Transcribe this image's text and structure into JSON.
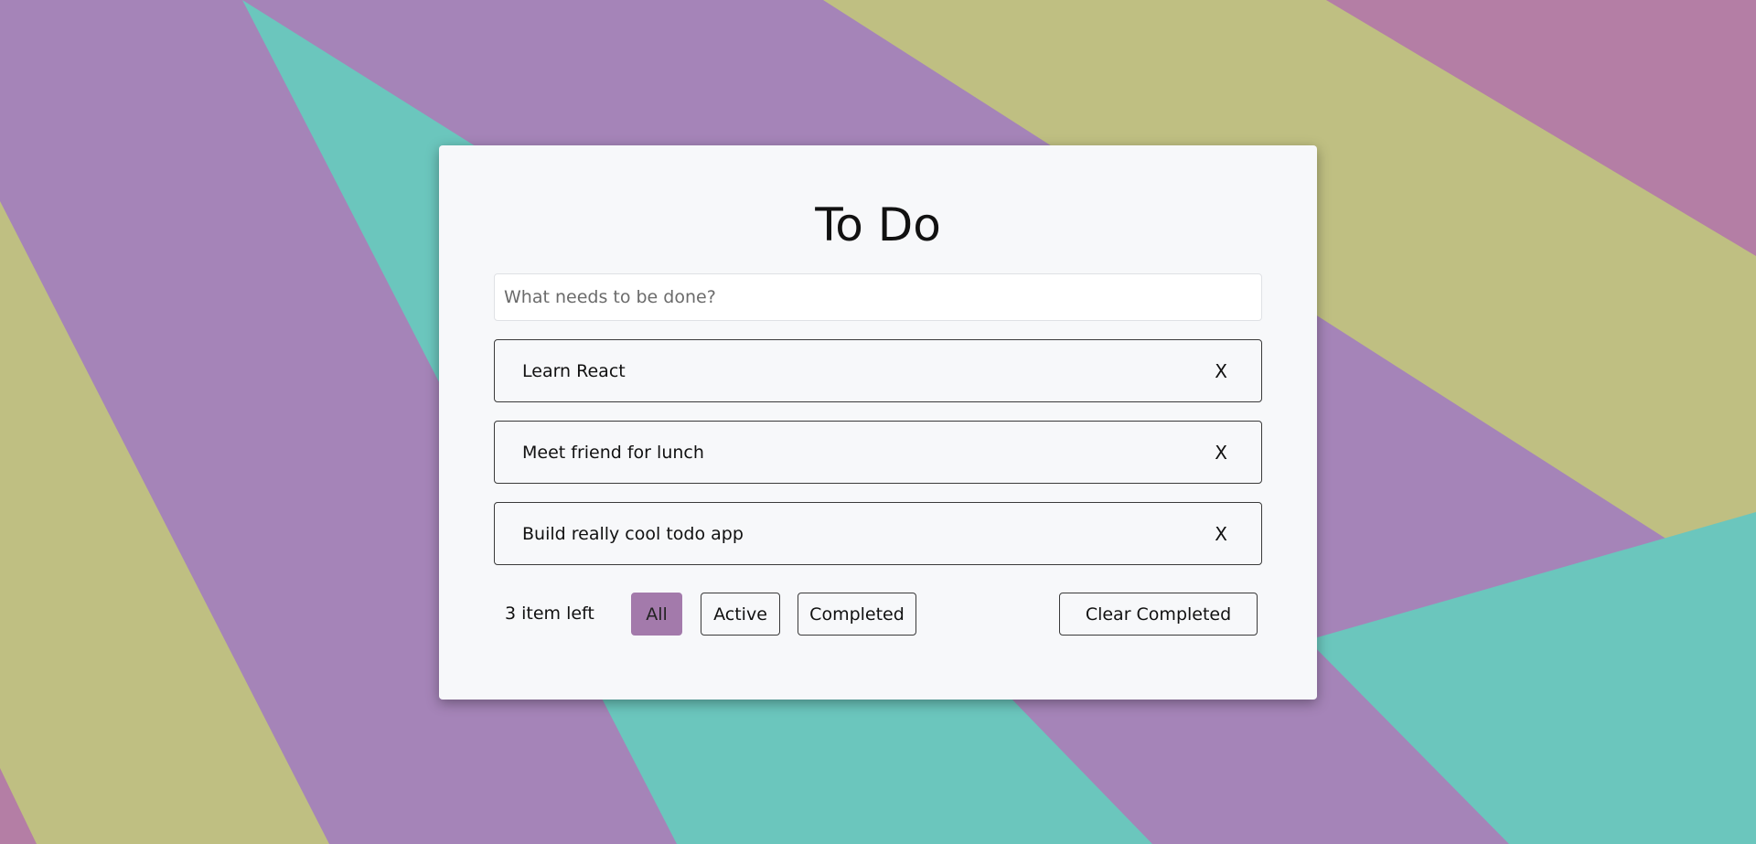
{
  "app": {
    "title": "To Do"
  },
  "new_todo": {
    "placeholder": "What needs to be done?",
    "value": ""
  },
  "todos": [
    {
      "text": "Learn React",
      "delete_label": "X"
    },
    {
      "text": "Meet friend for lunch",
      "delete_label": "X"
    },
    {
      "text": "Build really cool todo app",
      "delete_label": "X"
    }
  ],
  "footer": {
    "items_left": "3 item left",
    "filters": [
      {
        "label": "All",
        "selected": true
      },
      {
        "label": "Active",
        "selected": false
      },
      {
        "label": "Completed",
        "selected": false
      }
    ],
    "clear_label": "Clear Completed"
  },
  "colors": {
    "accent": "#a37aab",
    "card": "#f7f8fa",
    "bg_purple": "#a584b8",
    "bg_yellow": "#bfbf82",
    "bg_teal": "#6bc6bd",
    "bg_pink": "#b47ea5"
  }
}
